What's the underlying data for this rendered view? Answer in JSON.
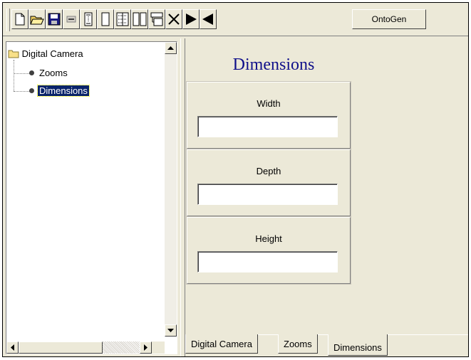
{
  "toolbar": {
    "buttons": [
      {
        "icon": "new-document-icon"
      },
      {
        "icon": "open-folder-icon"
      },
      {
        "icon": "save-disk-icon"
      },
      {
        "icon": "horizontal-bar-icon"
      },
      {
        "icon": "vertical-bar-icon"
      },
      {
        "icon": "panel-icon"
      },
      {
        "icon": "grid-icon"
      },
      {
        "icon": "columns-icon"
      },
      {
        "icon": "tree-layout-icon"
      },
      {
        "icon": "delete-x-icon"
      },
      {
        "icon": "play-forward-icon"
      },
      {
        "icon": "play-back-icon"
      }
    ],
    "ontogen_label": "OntoGen"
  },
  "tree": {
    "root_label": "Digital Camera",
    "items": [
      {
        "label": "Zooms",
        "selected": false
      },
      {
        "label": "Dimensions",
        "selected": true
      }
    ]
  },
  "form": {
    "title": "Dimensions",
    "fields": [
      {
        "label": "Width",
        "value": ""
      },
      {
        "label": "Depth",
        "value": ""
      },
      {
        "label": "Height",
        "value": ""
      }
    ]
  },
  "tabs": [
    {
      "label": "Digital Camera",
      "active": false
    },
    {
      "label": "Zooms",
      "active": false
    },
    {
      "label": "Dimensions",
      "active": true
    }
  ],
  "colors": {
    "title": "#10108a",
    "selection": "#0a246a",
    "background": "#ece9d8"
  }
}
